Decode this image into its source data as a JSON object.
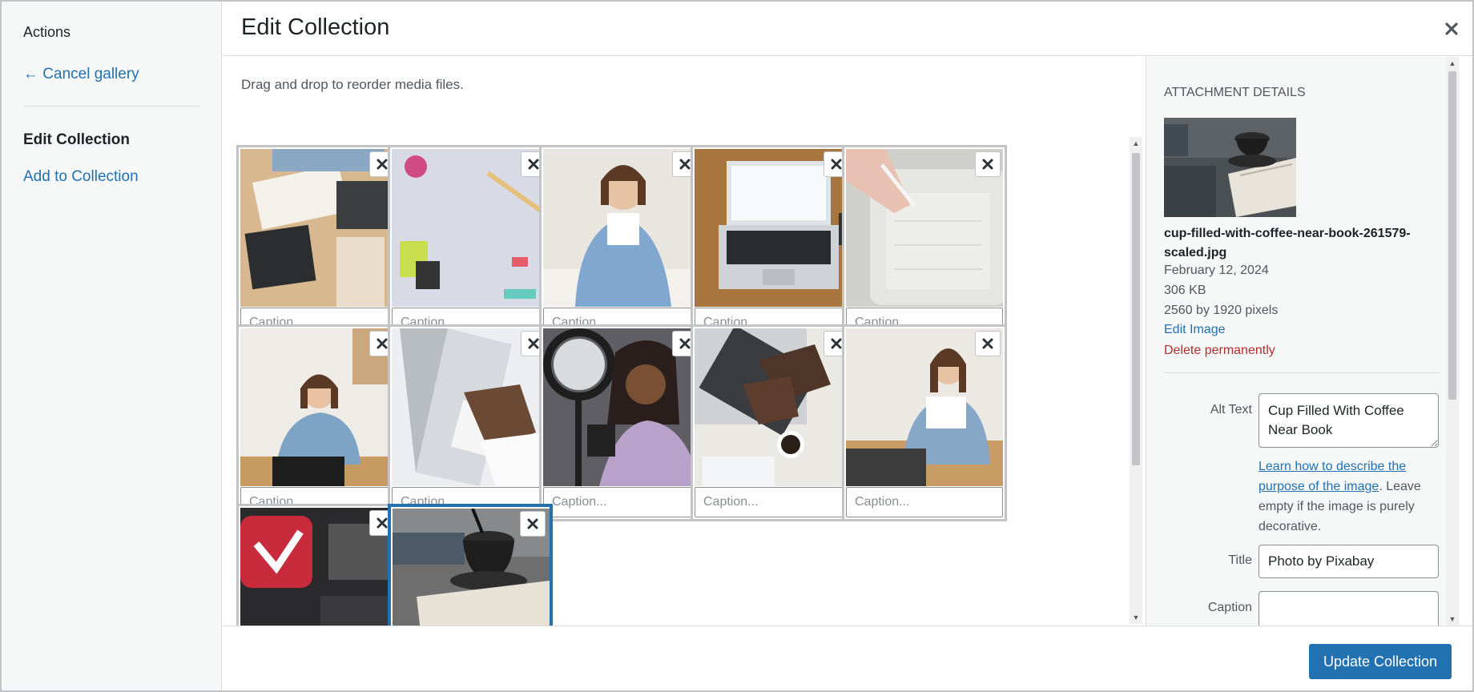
{
  "menu": {
    "heading": "Actions",
    "cancel_label": "← Cancel gallery",
    "active_label": "Edit Collection",
    "add_label": "Add to Collection"
  },
  "title": "Edit Collection",
  "instructions": "Drag and drop to reorder media files.",
  "caption_placeholder": "Caption...",
  "tiles": [
    {
      "subject": "writing in notebook at desk",
      "selected": false
    },
    {
      "subject": "pencil and binder clips",
      "selected": false
    },
    {
      "subject": "woman writing at desk",
      "selected": false
    },
    {
      "subject": "laptop on wooden desk",
      "selected": false
    },
    {
      "subject": "stylus on tablet planner",
      "selected": false
    },
    {
      "subject": "woman at laptop smiling",
      "selected": false
    },
    {
      "subject": "hands typing on laptop",
      "selected": false
    },
    {
      "subject": "woman with ring light",
      "selected": false
    },
    {
      "subject": "typing with coffee",
      "selected": false
    },
    {
      "subject": "woman thinking at desk",
      "selected": false
    },
    {
      "subject": "red app icon",
      "selected": false
    },
    {
      "subject": "cup of coffee near book",
      "selected": true
    }
  ],
  "details": {
    "section_title": "ATTACHMENT DETAILS",
    "filename": "cup-filled-with-coffee-near-book-261579-scaled.jpg",
    "date": "February 12, 2024",
    "size": "306 KB",
    "dimensions": "2560 by 1920 pixels",
    "edit_label": "Edit Image",
    "delete_label": "Delete permanently",
    "alt_label": "Alt Text",
    "alt_value": "Cup Filled With Coffee Near Book",
    "help_link": "Learn how to describe the purpose of the image",
    "help_rest": ". Leave empty if the image is purely decorative.",
    "title_label": "Title",
    "title_value": "Photo by Pixabay",
    "caption_label": "Caption",
    "caption_value": ""
  },
  "footer": {
    "update_label": "Update Collection"
  },
  "colors": {
    "accent": "#2271b1",
    "danger": "#b32d2e",
    "sidebar_bg": "#f6f7f7"
  }
}
